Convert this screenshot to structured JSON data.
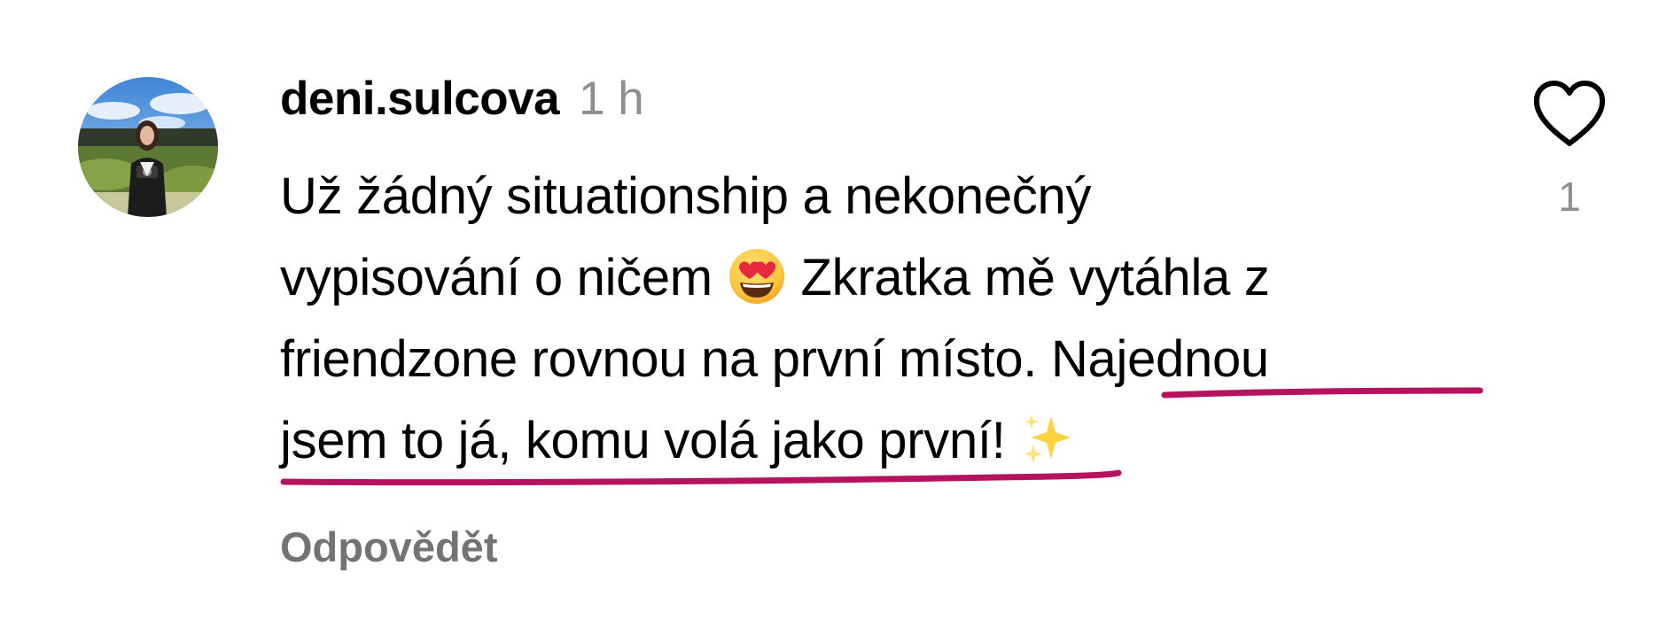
{
  "comment": {
    "username": "deni.sulcova",
    "timestamp": "1 h",
    "text_lines": [
      "Už žádný situationship a nekonečný",
      "vypisování o ničem",
      "Zkratka mě vytáhla z",
      "friendzone rovnou na první místo.",
      "Najednou",
      "jsem to já, komu volá jako první!"
    ],
    "emojis": {
      "first": "heart-eyes-emoji",
      "second": "sparkles-emoji"
    },
    "reply_label": "Odpovědět",
    "like_count": "1",
    "like_icon": "heart-outline-icon",
    "highlight_color": "#b5135e"
  }
}
